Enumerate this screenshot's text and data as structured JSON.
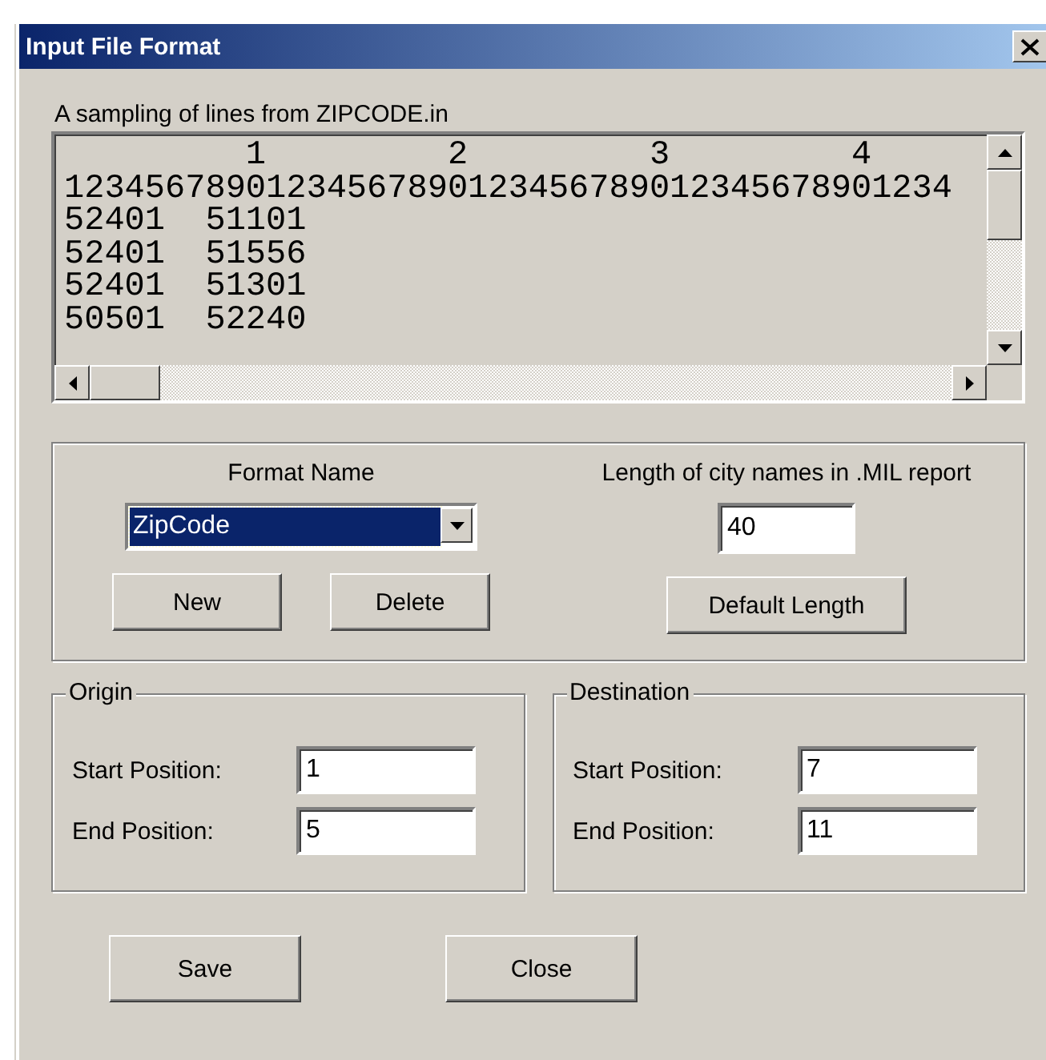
{
  "window": {
    "title": "Input File Format"
  },
  "sample": {
    "label": "A sampling of lines from ZIPCODE.in",
    "lines": [
      "         1         2         3         4",
      "12345678901234567890123456789012345678901234",
      "52401  51101",
      "52401  51556",
      "52401  51301",
      "50501  52240"
    ]
  },
  "format": {
    "name_label": "Format Name",
    "name_value": "ZipCode",
    "length_label": "Length of city names in .MIL report",
    "length_value": "40",
    "buttons": [
      "New",
      "Delete"
    ],
    "length_button": "Default Length"
  },
  "groups": [
    {
      "title": "Origin",
      "fields": [
        {
          "label": "Start Position:",
          "value": "1"
        },
        {
          "label": "End Position:",
          "value": "5"
        }
      ]
    },
    {
      "title": "Destination",
      "fields": [
        {
          "label": "Start Position:",
          "value": "7"
        },
        {
          "label": "End Position:",
          "value": "11"
        }
      ]
    }
  ],
  "buttons": [
    "Save",
    "Close"
  ]
}
